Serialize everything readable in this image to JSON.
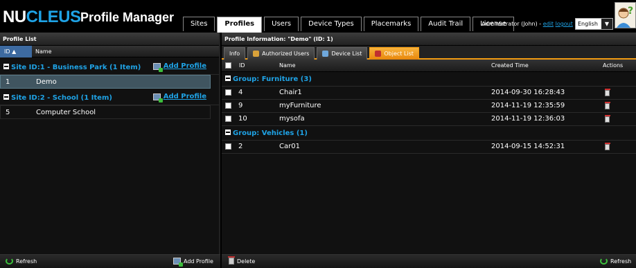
{
  "header": {
    "logo_nu": "NU",
    "logo_cleus": "CLEUS",
    "app_title": "Profile Manager",
    "tabs": [
      {
        "label": "Sites"
      },
      {
        "label": "Profiles",
        "active": true
      },
      {
        "label": "Users"
      },
      {
        "label": "Device Types"
      },
      {
        "label": "Placemarks"
      },
      {
        "label": "Audit Trail"
      },
      {
        "label": "License"
      }
    ],
    "user_text": "Administrator (John) - ",
    "edit_label": "edit",
    "logout_label": "logout",
    "language": "English"
  },
  "left_panel": {
    "title": "Profile List",
    "col_id": "ID",
    "col_name": "Name",
    "groups": [
      {
        "title": "Site ID:1 - Business Park (1 Item)",
        "add_label": "Add Profile",
        "rows": [
          {
            "id": "1",
            "name": "Demo"
          }
        ]
      },
      {
        "title": "Site ID:2 - School (1 Item)",
        "add_label": "Add Profile",
        "rows": [
          {
            "id": "5",
            "name": "Computer School"
          }
        ]
      }
    ],
    "refresh_label": "Refresh",
    "add_profile_label": "Add Profile"
  },
  "right_panel": {
    "title": "Profile Information: \"Demo\" (ID: 1)",
    "subtabs": [
      {
        "label": "Info"
      },
      {
        "label": "Authorized Users"
      },
      {
        "label": "Device List"
      },
      {
        "label": "Object List",
        "active": true
      }
    ],
    "columns": {
      "id": "ID",
      "name": "Name",
      "created": "Created Time",
      "actions": "Actions"
    },
    "groups": [
      {
        "title": "Group: Furniture (3)",
        "rows": [
          {
            "id": "4",
            "name": "Chair1",
            "created": "2014-09-30 16:28:43"
          },
          {
            "id": "9",
            "name": "myFurniture",
            "created": "2014-11-19 12:35:59"
          },
          {
            "id": "10",
            "name": "mysofa",
            "created": "2014-11-19 12:36:03"
          }
        ]
      },
      {
        "title": "Group: Vehicles (1)",
        "rows": [
          {
            "id": "2",
            "name": "Car01",
            "created": "2014-09-15 14:52:31"
          }
        ]
      }
    ],
    "delete_label": "Delete",
    "refresh_label": "Refresh"
  },
  "colors": {
    "accent": "#1fa3e6",
    "selected_row": "#405560",
    "active_subtab": "#f39c12"
  }
}
